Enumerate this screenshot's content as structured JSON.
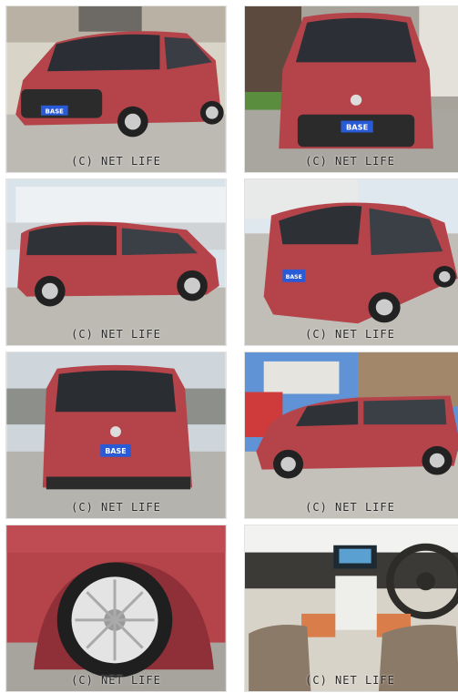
{
  "watermark": "(C) NET LIFE",
  "plate_label": "BASE",
  "colors": {
    "body": "#b5434a",
    "body_shade": "#8f2f37",
    "ground": "#bdbab3",
    "sky": "#dfe9f2",
    "plate": "#2a5bd7"
  }
}
